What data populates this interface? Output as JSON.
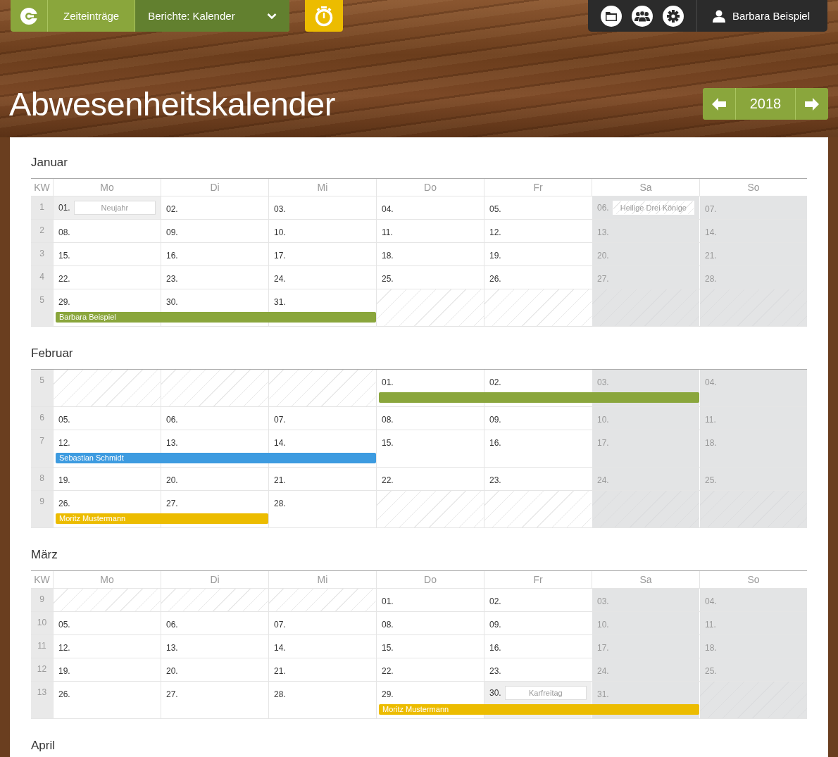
{
  "nav": {
    "tabs": [
      {
        "label": "Zeiteinträge",
        "kind": "tab",
        "selected": false
      },
      {
        "label": "Berichte: Kalender",
        "kind": "dropdown",
        "selected": true
      }
    ]
  },
  "user": {
    "name": "Barbara Beispiel"
  },
  "page_title": "Abwesenheitskalender",
  "year_nav": {
    "year": "2018"
  },
  "months": [
    {
      "name": "Januar",
      "columns": [
        "KW",
        "Mo",
        "Di",
        "Mi",
        "Do",
        "Fr",
        "Sa",
        "So"
      ],
      "weeks": [
        {
          "kw": "1",
          "days": [
            {
              "kind": "day",
              "date": "01.",
              "holiday": "Neujahr",
              "weekend": false
            },
            {
              "kind": "day",
              "date": "02.",
              "weekend": false
            },
            {
              "kind": "day",
              "date": "03.",
              "weekend": false
            },
            {
              "kind": "day",
              "date": "04.",
              "weekend": false
            },
            {
              "kind": "day",
              "date": "05.",
              "weekend": false
            },
            {
              "kind": "day",
              "date": "06.",
              "holiday": "Heilige Drei Könige",
              "weekend": true
            },
            {
              "kind": "day",
              "date": "07.",
              "weekend": true
            }
          ]
        },
        {
          "kw": "2",
          "days": [
            {
              "kind": "day",
              "date": "08.",
              "weekend": false
            },
            {
              "kind": "day",
              "date": "09.",
              "weekend": false
            },
            {
              "kind": "day",
              "date": "10.",
              "weekend": false
            },
            {
              "kind": "day",
              "date": "11.",
              "weekend": false
            },
            {
              "kind": "day",
              "date": "12.",
              "weekend": false
            },
            {
              "kind": "day",
              "date": "13.",
              "weekend": true
            },
            {
              "kind": "day",
              "date": "14.",
              "weekend": true
            }
          ]
        },
        {
          "kw": "3",
          "days": [
            {
              "kind": "day",
              "date": "15.",
              "weekend": false
            },
            {
              "kind": "day",
              "date": "16.",
              "weekend": false
            },
            {
              "kind": "day",
              "date": "17.",
              "weekend": false
            },
            {
              "kind": "day",
              "date": "18.",
              "weekend": false
            },
            {
              "kind": "day",
              "date": "19.",
              "weekend": false
            },
            {
              "kind": "day",
              "date": "20.",
              "weekend": true
            },
            {
              "kind": "day",
              "date": "21.",
              "weekend": true
            }
          ]
        },
        {
          "kw": "4",
          "days": [
            {
              "kind": "day",
              "date": "22.",
              "weekend": false
            },
            {
              "kind": "day",
              "date": "23.",
              "weekend": false
            },
            {
              "kind": "day",
              "date": "24.",
              "weekend": false
            },
            {
              "kind": "day",
              "date": "25.",
              "weekend": false
            },
            {
              "kind": "day",
              "date": "26.",
              "weekend": false
            },
            {
              "kind": "day",
              "date": "27.",
              "weekend": true
            },
            {
              "kind": "day",
              "date": "28.",
              "weekend": true
            }
          ]
        },
        {
          "kw": "5",
          "absence": {
            "name": "Barbara Beispiel",
            "color": "#8aa63c"
          },
          "days": [
            {
              "kind": "day",
              "date": "29.",
              "weekend": false,
              "absent": true
            },
            {
              "kind": "day",
              "date": "30.",
              "weekend": false,
              "absent": true
            },
            {
              "kind": "day",
              "date": "31.",
              "weekend": false,
              "absent": true
            },
            {
              "kind": "blank",
              "weekend": false
            },
            {
              "kind": "blank",
              "weekend": false
            },
            {
              "kind": "blank",
              "weekend": true
            },
            {
              "kind": "blank",
              "weekend": true
            }
          ]
        }
      ]
    },
    {
      "name": "Februar",
      "weeks": [
        {
          "kw": "5",
          "absence": {
            "color": "#8aa63c"
          },
          "days": [
            {
              "kind": "blank",
              "weekend": false
            },
            {
              "kind": "blank",
              "weekend": false
            },
            {
              "kind": "blank",
              "weekend": false
            },
            {
              "kind": "day",
              "date": "01.",
              "weekend": false,
              "absent": true
            },
            {
              "kind": "day",
              "date": "02.",
              "weekend": false,
              "absent": true
            },
            {
              "kind": "day",
              "date": "03.",
              "weekend": true,
              "absent": true
            },
            {
              "kind": "day",
              "date": "04.",
              "weekend": true
            }
          ]
        },
        {
          "kw": "6",
          "days": [
            {
              "kind": "day",
              "date": "05.",
              "weekend": false
            },
            {
              "kind": "day",
              "date": "06.",
              "weekend": false
            },
            {
              "kind": "day",
              "date": "07.",
              "weekend": false
            },
            {
              "kind": "day",
              "date": "08.",
              "weekend": false
            },
            {
              "kind": "day",
              "date": "09.",
              "weekend": false
            },
            {
              "kind": "day",
              "date": "10.",
              "weekend": true
            },
            {
              "kind": "day",
              "date": "11.",
              "weekend": true
            }
          ]
        },
        {
          "kw": "7",
          "absence": {
            "name": "Sebastian Schmidt",
            "color": "#3d9be0"
          },
          "days": [
            {
              "kind": "day",
              "date": "12.",
              "weekend": false,
              "absent": true
            },
            {
              "kind": "day",
              "date": "13.",
              "weekend": false,
              "absent": true
            },
            {
              "kind": "day",
              "date": "14.",
              "weekend": false,
              "absent": true
            },
            {
              "kind": "day",
              "date": "15.",
              "weekend": false
            },
            {
              "kind": "day",
              "date": "16.",
              "weekend": false
            },
            {
              "kind": "day",
              "date": "17.",
              "weekend": true
            },
            {
              "kind": "day",
              "date": "18.",
              "weekend": true
            }
          ]
        },
        {
          "kw": "8",
          "days": [
            {
              "kind": "day",
              "date": "19.",
              "weekend": false
            },
            {
              "kind": "day",
              "date": "20.",
              "weekend": false
            },
            {
              "kind": "day",
              "date": "21.",
              "weekend": false
            },
            {
              "kind": "day",
              "date": "22.",
              "weekend": false
            },
            {
              "kind": "day",
              "date": "23.",
              "weekend": false
            },
            {
              "kind": "day",
              "date": "24.",
              "weekend": true
            },
            {
              "kind": "day",
              "date": "25.",
              "weekend": true
            }
          ]
        },
        {
          "kw": "9",
          "absence": {
            "name": "Moritz Mustermann",
            "color": "#ecbc00"
          },
          "days": [
            {
              "kind": "day",
              "date": "26.",
              "weekend": false,
              "absent": true
            },
            {
              "kind": "day",
              "date": "27.",
              "weekend": false,
              "absent": true
            },
            {
              "kind": "day",
              "date": "28.",
              "weekend": false
            },
            {
              "kind": "blank",
              "weekend": false
            },
            {
              "kind": "blank",
              "weekend": false
            },
            {
              "kind": "blank",
              "weekend": true
            },
            {
              "kind": "blank",
              "weekend": true
            }
          ]
        }
      ]
    },
    {
      "name": "März",
      "columns": [
        "KW",
        "Mo",
        "Di",
        "Mi",
        "Do",
        "Fr",
        "Sa",
        "So"
      ],
      "weeks": [
        {
          "kw": "9",
          "days": [
            {
              "kind": "blank",
              "weekend": false
            },
            {
              "kind": "blank",
              "weekend": false
            },
            {
              "kind": "blank",
              "weekend": false
            },
            {
              "kind": "day",
              "date": "01.",
              "weekend": false
            },
            {
              "kind": "day",
              "date": "02.",
              "weekend": false
            },
            {
              "kind": "day",
              "date": "03.",
              "weekend": true
            },
            {
              "kind": "day",
              "date": "04.",
              "weekend": true
            }
          ]
        },
        {
          "kw": "10",
          "days": [
            {
              "kind": "day",
              "date": "05.",
              "weekend": false
            },
            {
              "kind": "day",
              "date": "06.",
              "weekend": false
            },
            {
              "kind": "day",
              "date": "07.",
              "weekend": false
            },
            {
              "kind": "day",
              "date": "08.",
              "weekend": false
            },
            {
              "kind": "day",
              "date": "09.",
              "weekend": false
            },
            {
              "kind": "day",
              "date": "10.",
              "weekend": true
            },
            {
              "kind": "day",
              "date": "11.",
              "weekend": true
            }
          ]
        },
        {
          "kw": "11",
          "days": [
            {
              "kind": "day",
              "date": "12.",
              "weekend": false
            },
            {
              "kind": "day",
              "date": "13.",
              "weekend": false
            },
            {
              "kind": "day",
              "date": "14.",
              "weekend": false
            },
            {
              "kind": "day",
              "date": "15.",
              "weekend": false
            },
            {
              "kind": "day",
              "date": "16.",
              "weekend": false
            },
            {
              "kind": "day",
              "date": "17.",
              "weekend": true
            },
            {
              "kind": "day",
              "date": "18.",
              "weekend": true
            }
          ]
        },
        {
          "kw": "12",
          "days": [
            {
              "kind": "day",
              "date": "19.",
              "weekend": false
            },
            {
              "kind": "day",
              "date": "20.",
              "weekend": false
            },
            {
              "kind": "day",
              "date": "21.",
              "weekend": false
            },
            {
              "kind": "day",
              "date": "22.",
              "weekend": false
            },
            {
              "kind": "day",
              "date": "23.",
              "weekend": false
            },
            {
              "kind": "day",
              "date": "24.",
              "weekend": true
            },
            {
              "kind": "day",
              "date": "25.",
              "weekend": true
            }
          ]
        },
        {
          "kw": "13",
          "absence": {
            "name": "Moritz Mustermann",
            "color": "#ecbc00"
          },
          "days": [
            {
              "kind": "day",
              "date": "26.",
              "weekend": false
            },
            {
              "kind": "day",
              "date": "27.",
              "weekend": false
            },
            {
              "kind": "day",
              "date": "28.",
              "weekend": false
            },
            {
              "kind": "day",
              "date": "29.",
              "weekend": false,
              "absent": true
            },
            {
              "kind": "day",
              "date": "30.",
              "holiday": "Karfreitag",
              "weekend": false,
              "absent": true
            },
            {
              "kind": "day",
              "date": "31.",
              "weekend": true,
              "absent": true
            },
            {
              "kind": "blank",
              "weekend": true
            }
          ]
        }
      ]
    },
    {
      "name": "April"
    }
  ]
}
